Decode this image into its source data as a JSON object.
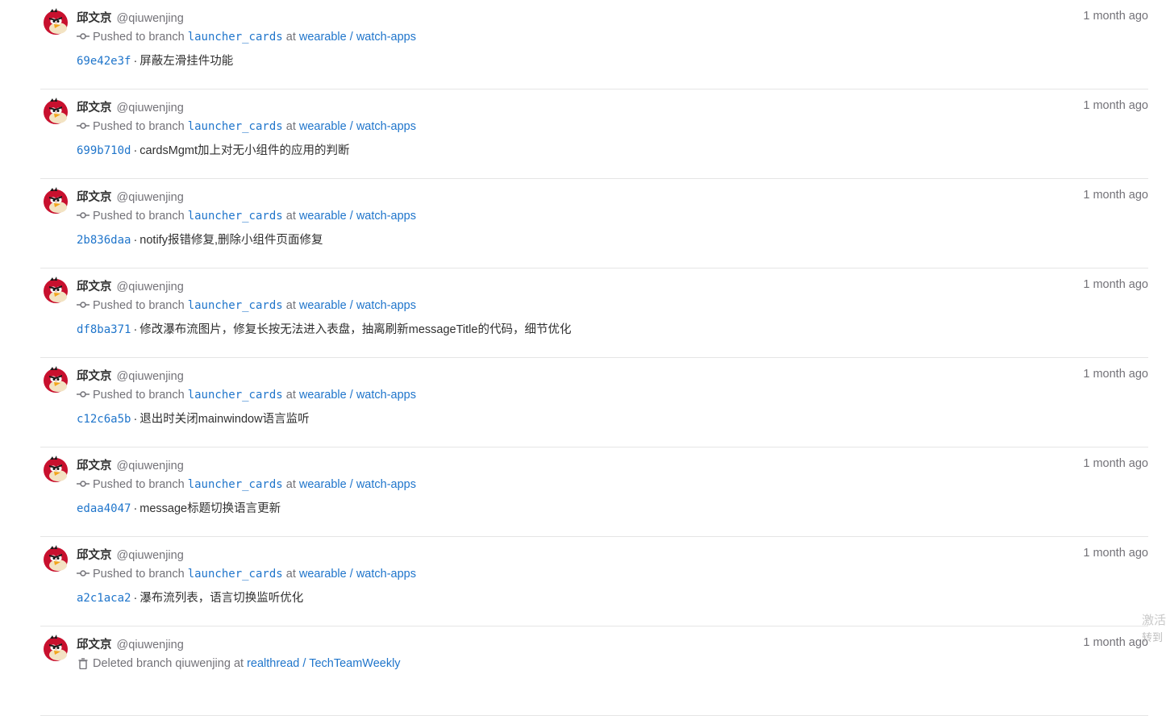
{
  "events": [
    {
      "author_name": "邱文京",
      "author_handle": "@qiuwenjing",
      "time": "1 month ago",
      "action_icon": "commit-icon",
      "action_prefix": "Pushed to branch",
      "branch": "launcher_cards",
      "at": "at",
      "namespace": "wearable",
      "slash": "/",
      "project": "watch-apps",
      "commit_sha": "69e42e3f",
      "commit_sep": "·",
      "commit_title": "屏蔽左滑挂件功能"
    },
    {
      "author_name": "邱文京",
      "author_handle": "@qiuwenjing",
      "time": "1 month ago",
      "action_icon": "commit-icon",
      "action_prefix": "Pushed to branch",
      "branch": "launcher_cards",
      "at": "at",
      "namespace": "wearable",
      "slash": "/",
      "project": "watch-apps",
      "commit_sha": "699b710d",
      "commit_sep": "·",
      "commit_title": "cardsMgmt加上对无小组件的应用的判断"
    },
    {
      "author_name": "邱文京",
      "author_handle": "@qiuwenjing",
      "time": "1 month ago",
      "action_icon": "commit-icon",
      "action_prefix": "Pushed to branch",
      "branch": "launcher_cards",
      "at": "at",
      "namespace": "wearable",
      "slash": "/",
      "project": "watch-apps",
      "commit_sha": "2b836daa",
      "commit_sep": "·",
      "commit_title": "notify报错修复,删除小组件页面修复"
    },
    {
      "author_name": "邱文京",
      "author_handle": "@qiuwenjing",
      "time": "1 month ago",
      "action_icon": "commit-icon",
      "action_prefix": "Pushed to branch",
      "branch": "launcher_cards",
      "at": "at",
      "namespace": "wearable",
      "slash": "/",
      "project": "watch-apps",
      "commit_sha": "df8ba371",
      "commit_sep": "·",
      "commit_title": "修改瀑布流图片，修复长按无法进入表盘，抽离刷新messageTitle的代码，细节优化"
    },
    {
      "author_name": "邱文京",
      "author_handle": "@qiuwenjing",
      "time": "1 month ago",
      "action_icon": "commit-icon",
      "action_prefix": "Pushed to branch",
      "branch": "launcher_cards",
      "at": "at",
      "namespace": "wearable",
      "slash": "/",
      "project": "watch-apps",
      "commit_sha": "c12c6a5b",
      "commit_sep": "·",
      "commit_title": "退出时关闭mainwindow语言监听"
    },
    {
      "author_name": "邱文京",
      "author_handle": "@qiuwenjing",
      "time": "1 month ago",
      "action_icon": "commit-icon",
      "action_prefix": "Pushed to branch",
      "branch": "launcher_cards",
      "at": "at",
      "namespace": "wearable",
      "slash": "/",
      "project": "watch-apps",
      "commit_sha": "edaa4047",
      "commit_sep": "·",
      "commit_title": "message标题切换语言更新"
    },
    {
      "author_name": "邱文京",
      "author_handle": "@qiuwenjing",
      "time": "1 month ago",
      "action_icon": "commit-icon",
      "action_prefix": "Pushed to branch",
      "branch": "launcher_cards",
      "at": "at",
      "namespace": "wearable",
      "slash": "/",
      "project": "watch-apps",
      "commit_sha": "a2c1aca2",
      "commit_sep": "·",
      "commit_title": "瀑布流列表，语言切换监听优化"
    },
    {
      "author_name": "邱文京",
      "author_handle": "@qiuwenjing",
      "time": "1 month ago",
      "action_icon": "trash-icon",
      "action_prefix": "Deleted branch qiuwenjing",
      "branch": "",
      "at": "at",
      "namespace": "realthread",
      "slash": "/",
      "project": "TechTeamWeekly"
    }
  ],
  "watermark": {
    "line1": "激活",
    "line2": "转到"
  },
  "colors": {
    "link": "#1f75cb",
    "muted": "#737278",
    "text": "#303030",
    "divider": "#e5e5e5",
    "avatar_red": "#c8102e"
  }
}
